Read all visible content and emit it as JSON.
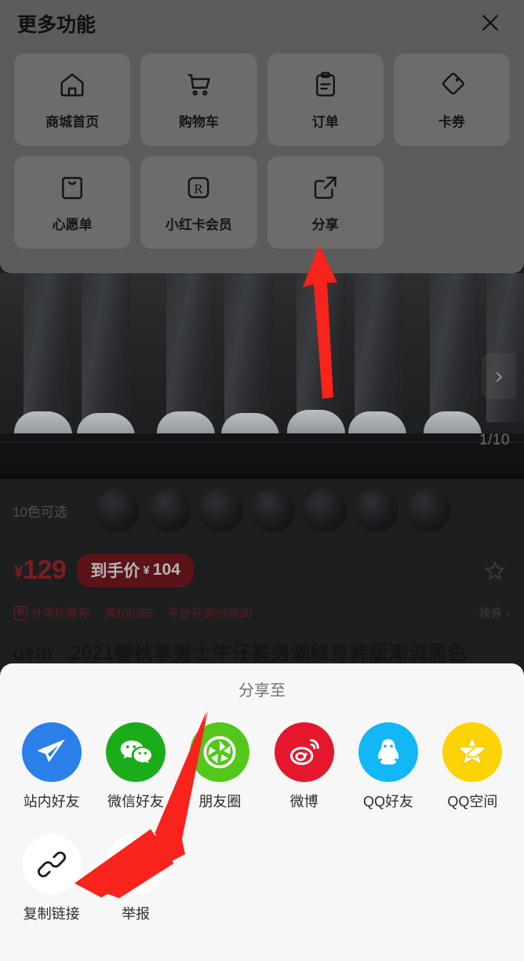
{
  "more_panel": {
    "title": "更多功能",
    "close_icon": "close-icon",
    "items": [
      {
        "label": "商城首页",
        "icon": "home-icon"
      },
      {
        "label": "购物车",
        "icon": "shopping-cart-icon"
      },
      {
        "label": "订单",
        "icon": "clipboard-order-icon"
      },
      {
        "label": "卡券",
        "icon": "coupon-tag-icon"
      },
      {
        "label": "心愿单",
        "icon": "wishlist-bag-icon"
      },
      {
        "label": "小红卡会员",
        "icon": "r-badge-icon"
      },
      {
        "label": "分享",
        "icon": "share-external-link-icon"
      }
    ]
  },
  "product": {
    "pager": "1/10",
    "next_chevron": "›",
    "color_label": "10色可选",
    "swatch_count": 7,
    "price": "129",
    "currency": "¥",
    "deal_pill_label": "到手价",
    "deal_price": "104",
    "promos": [
      "分享抢薯券",
      "满100减5",
      "平台券满99减20"
    ],
    "promo_badge_char": "券",
    "coupon_link": "领券",
    "coupon_chevron": "›",
    "title": "oeln · 2021春秋季男士牛仔裤男潮修身韩版潮流黑色",
    "favorite_icon": "star-outline-icon"
  },
  "share_sheet": {
    "title": "分享至",
    "items": [
      {
        "label": "站内好友",
        "icon": "send-plane-icon",
        "color": "#2b7fe8"
      },
      {
        "label": "微信好友",
        "icon": "wechat-icon",
        "color": "#1aad19"
      },
      {
        "label": "朋友圈",
        "icon": "moments-aperture-icon",
        "color": "#53c71a"
      },
      {
        "label": "微博",
        "icon": "weibo-icon",
        "color": "#e6162d"
      },
      {
        "label": "QQ好友",
        "icon": "qq-penguin-icon",
        "color": "#12b7f5"
      },
      {
        "label": "QQ空间",
        "icon": "qzone-star-icon",
        "color": "#fcd307"
      },
      {
        "label": "复制链接",
        "icon": "link-chain-icon",
        "color": "#ffffff"
      },
      {
        "label": "举报",
        "icon": "warning-triangle-icon",
        "color": "#ffffff"
      }
    ]
  },
  "annotations": {
    "arrow_color": "#f8231b",
    "arrow_share_button": "points at 分享 tile in more-functions panel",
    "arrow_copy_link": "points at 复制链接 item in share sheet"
  }
}
